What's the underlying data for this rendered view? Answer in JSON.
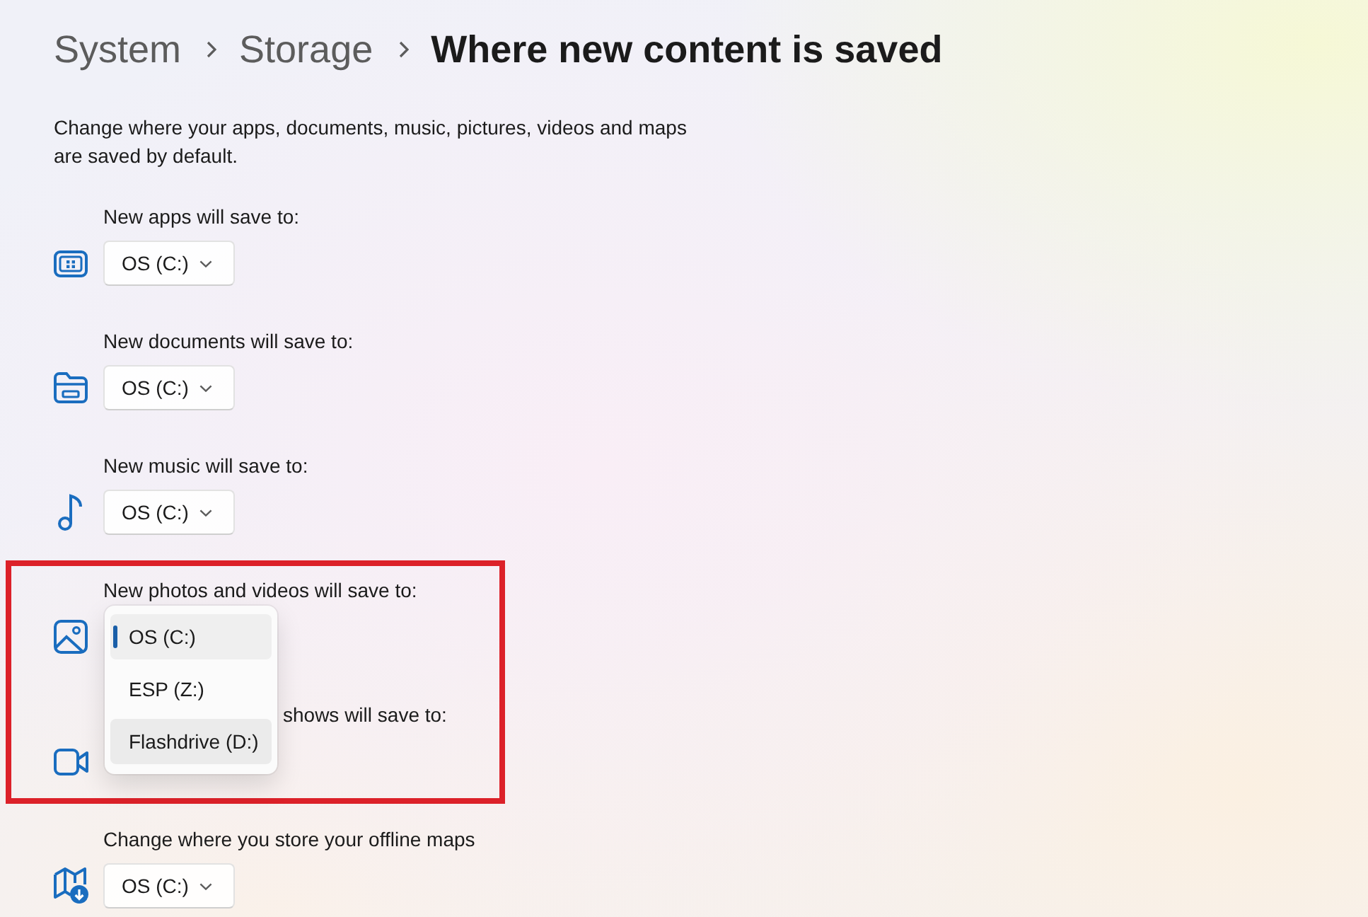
{
  "breadcrumb": [
    {
      "label": "System",
      "current": false
    },
    {
      "label": "Storage",
      "current": false
    },
    {
      "label": "Where new content is saved",
      "current": true
    }
  ],
  "description": "Change where your apps, documents, music, pictures, videos and maps are saved by default.",
  "sections": [
    {
      "kind": "apps",
      "label": "New apps will save to:",
      "highlighted": false,
      "dropdown": {
        "value": "OS (C:)",
        "expanded": false
      }
    },
    {
      "kind": "documents",
      "label": "New documents will save to:",
      "highlighted": false,
      "dropdown": {
        "value": "OS (C:)",
        "expanded": false
      }
    },
    {
      "kind": "music",
      "label": "New music will save to:",
      "highlighted": false,
      "dropdown": {
        "value": "OS (C:)",
        "expanded": false
      }
    },
    {
      "kind": "photos",
      "label": "New photos and videos will save to:",
      "highlighted": true,
      "dropdown": {
        "expanded": true,
        "options": [
          {
            "label": "OS (C:)",
            "selected": true,
            "hovered": false
          },
          {
            "label": "ESP (Z:)",
            "selected": false,
            "hovered": false
          },
          {
            "label": "Flashdrive (D:)",
            "selected": false,
            "hovered": true
          }
        ]
      }
    },
    {
      "kind": "videos",
      "label": "shows will save to:",
      "highlighted": true
    },
    {
      "kind": "maps",
      "label": "Change where you store your offline maps",
      "highlighted": false,
      "dropdown": {
        "value": "OS (C:)",
        "expanded": false
      }
    }
  ]
}
